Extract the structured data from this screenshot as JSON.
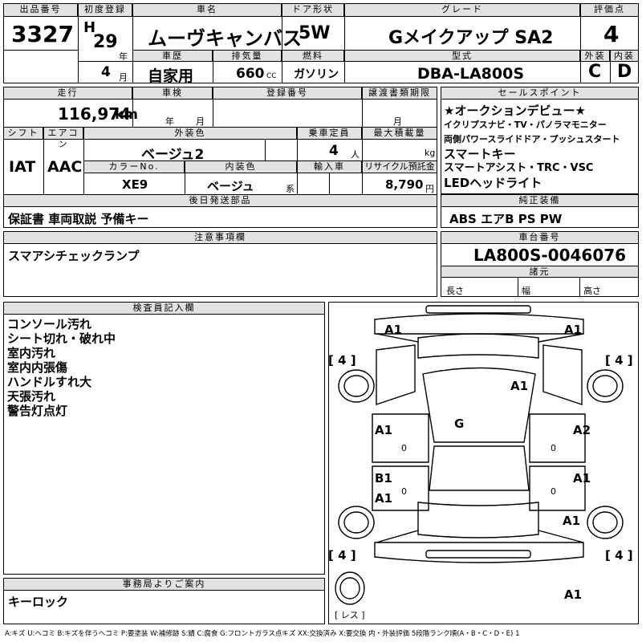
{
  "headers": {
    "lot_no": "出品番号",
    "first_reg": "初度登録",
    "car_name": "車名",
    "door": "ドア形状",
    "grade": "グレード",
    "score": "評価点",
    "history": "車歴",
    "displacement": "排気量",
    "fuel": "燃料",
    "model": "型式",
    "ext": "外装",
    "int": "内装",
    "mileage": "走行",
    "inspection": "車検",
    "reg_no": "登録番号",
    "transfer": "譲渡書類期限",
    "shift": "シフト",
    "ac": "エアコン",
    "color": "外装色",
    "capacity": "乗車定員",
    "max_load": "最大積載量",
    "color_no": "カラーNo.",
    "interior_color": "内装色",
    "import": "輸入車",
    "recycle": "リサイクル預託金",
    "later_parts": "後日発送部品",
    "notes": "注意事項欄",
    "sales_points": "セールスポイント",
    "genuine_equip": "純正装備",
    "chassis_no": "車台番号",
    "specs": "諸元",
    "inspector": "検査員記入欄",
    "office": "事務局よりご案内"
  },
  "units": {
    "year": "年",
    "month": "月",
    "cc": "CC",
    "km": "km",
    "person": "人",
    "kg": "kg",
    "yen": "円",
    "system": "系",
    "length": "長さ",
    "width": "幅",
    "height": "高さ"
  },
  "values": {
    "lot_no": "3327",
    "era": "H",
    "year": "29",
    "month": "4",
    "car_name": "ムーヴキャンバス",
    "door": "5W",
    "grade": "Gメイクアップ SA2",
    "score": "4",
    "history": "自家用",
    "displacement": "660",
    "fuel": "ガソリン",
    "model": "DBA-LA800S",
    "ext_grade": "C",
    "int_grade": "D",
    "mileage": "116,974",
    "shift": "IAT",
    "ac": "AAC",
    "color": "ベージュ2",
    "capacity": "4",
    "color_no": "XE9",
    "interior_color": "ベージュ",
    "recycle": "8,790",
    "later_parts": "保証書 車両取説 予備キー",
    "notes": "スマアシチェックランプ",
    "sales_points": [
      "★オークションデビュー★",
      "イクリプスナビ・TV・パノラマモニター",
      "両側パワースライドドア・プッシュスタート",
      "スマートキー",
      "スマートアシスト・TRC・VSC",
      "LEDヘッドライト"
    ],
    "genuine_equip": "ABS エアB PS PW",
    "chassis_no": "LA800S-0046076",
    "inspector_notes": [
      "コンソール汚れ",
      "シート切れ・破れ中",
      "室内汚れ",
      "室内内張傷",
      "ハンドルすれ大",
      "天張汚れ",
      "警告灯点灯"
    ],
    "office_note": "キーロック"
  },
  "diagram": {
    "marks": [
      "A1",
      "A1",
      "A1",
      "G",
      "A1",
      "A2",
      "B1",
      "A1",
      "A1",
      "A1",
      "A1"
    ],
    "zeros": [
      "0",
      "0",
      "0",
      "0"
    ],
    "tire_left_front": "[ 4 ]",
    "tire_right_front": "[ 4 ]",
    "tire_left_rear": "[ 4 ]",
    "tire_right_rear": "[ 4 ]",
    "spare": "[ レス ]"
  },
  "legend": "A:キズ U:ヘコミ B:キズを伴うヘコミ P:要塗装 W:補修跡 S:錆 C:腐食 G:フロントガラス点キズ XX:交換済み X:要交換 内・外装評価 5段階ランク順(A・B・C・D・E) 1"
}
